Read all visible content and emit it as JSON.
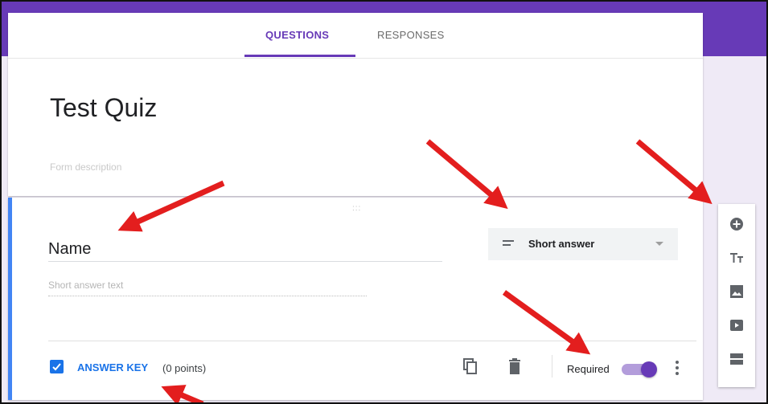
{
  "tabs": {
    "questions": "QUESTIONS",
    "responses": "RESPONSES"
  },
  "form": {
    "title": "Test Quiz",
    "description_placeholder": "Form description"
  },
  "question": {
    "title": "Name",
    "type": "Short answer",
    "answer_placeholder": "Short answer text",
    "drag_handle": ":::",
    "answer_key_label": "ANSWER KEY",
    "points": "(0 points)",
    "required_label": "Required",
    "required": true
  },
  "toolbar": {
    "items": [
      "add-question-icon",
      "add-title-icon",
      "add-image-icon",
      "add-video-icon",
      "add-section-icon"
    ]
  },
  "colors": {
    "accent": "#673ab7",
    "link": "#1a73e8",
    "annotation": "#e31e1e"
  }
}
